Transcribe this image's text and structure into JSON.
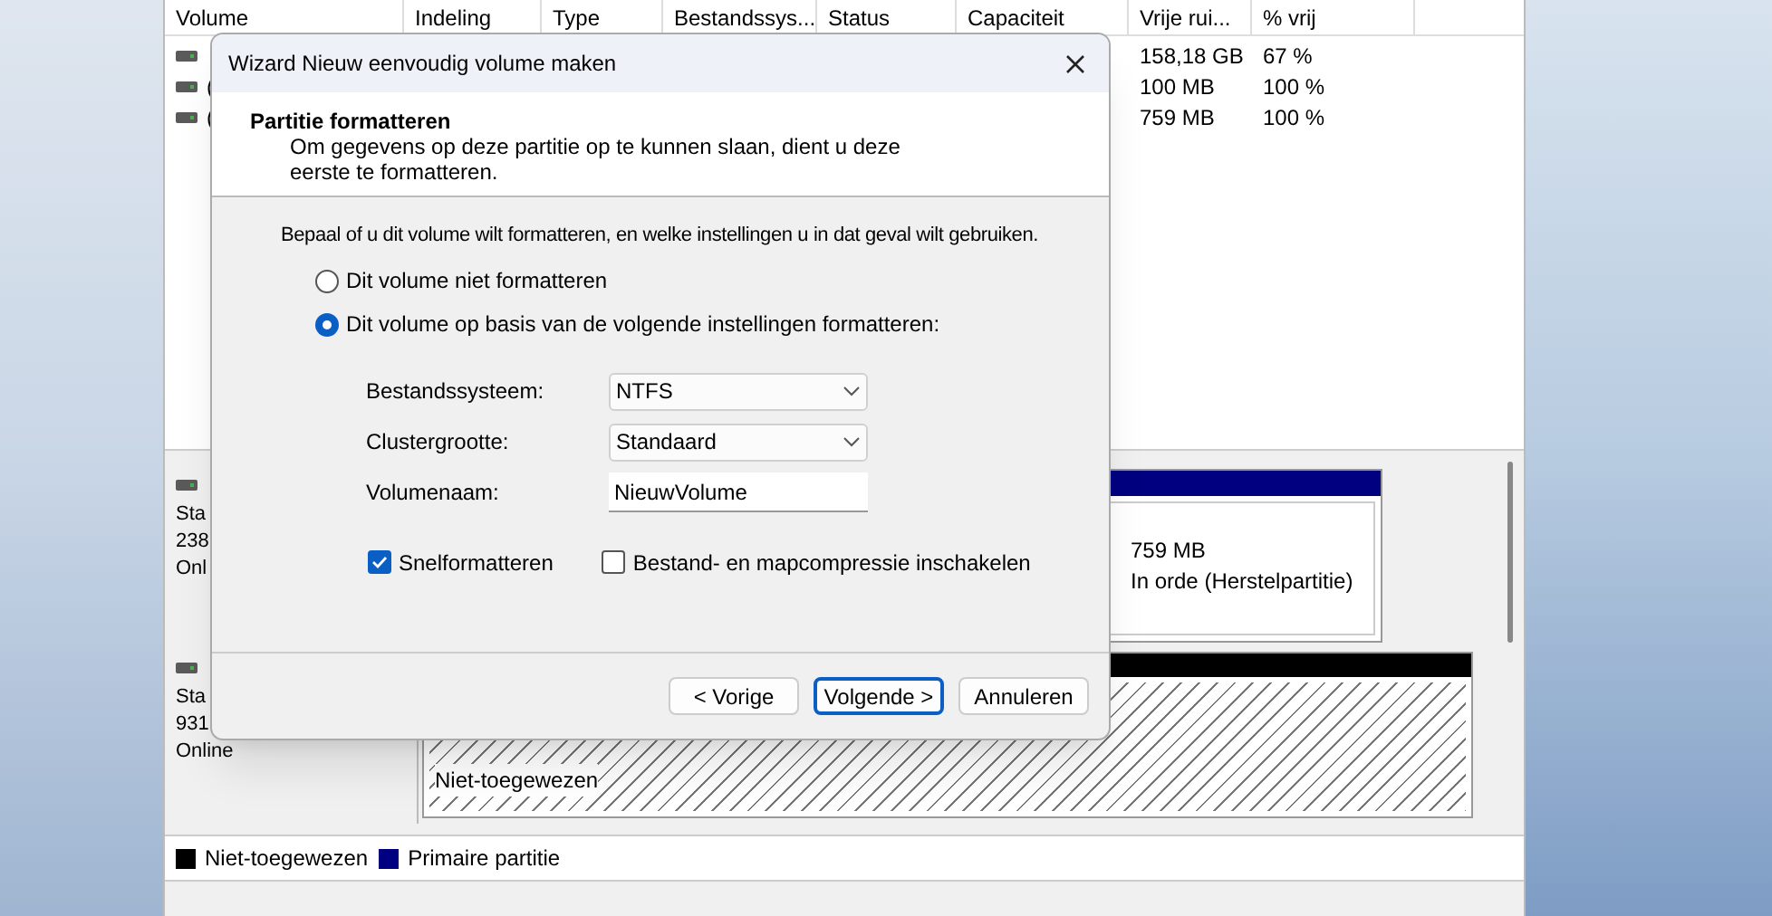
{
  "table": {
    "columns": [
      "Volume",
      "Indeling",
      "Type",
      "Bestandssys...",
      "Status",
      "Capaciteit",
      "Vrije rui...",
      "% vrij"
    ],
    "rows": [
      {
        "free": "158,18 GB",
        "percent": "67 %"
      },
      {
        "volume": "(",
        "free": "100 MB",
        "percent": "100 %"
      },
      {
        "volume": "(",
        "free": "759 MB",
        "percent": "100 %"
      }
    ]
  },
  "disks": [
    {
      "lines": [
        "Sta",
        "238",
        "Onl"
      ],
      "partitions": [
        {
          "kind": "primary",
          "size": "759 MB",
          "status": "In orde (Herstelpartitie)"
        }
      ]
    },
    {
      "lines": [
        "Sta",
        "931",
        "Online"
      ],
      "partitions": [
        {
          "kind": "unallocated",
          "label": "Niet-toegewezen"
        }
      ]
    }
  ],
  "legend": [
    {
      "label": "Niet-toegewezen",
      "color": "#000000"
    },
    {
      "label": "Primaire partitie",
      "color": "#000080"
    }
  ],
  "dialog": {
    "title": "Wizard Nieuw eenvoudig volume maken",
    "heading": "Partitie formatteren",
    "description": "Om gegevens op deze partitie op te kunnen slaan, dient u deze eerste te formatteren.",
    "instruction": "Bepaal of u dit volume wilt formatteren, en welke instellingen u in dat geval wilt gebruiken.",
    "options": [
      {
        "label": "Dit volume niet formatteren",
        "selected": false
      },
      {
        "label": "Dit volume op basis van de volgende instellingen formatteren:",
        "selected": true
      }
    ],
    "fields": [
      {
        "kind": "select",
        "label": "Bestandssysteem:",
        "value": "NTFS"
      },
      {
        "kind": "select",
        "label": "Clustergrootte:",
        "value": "Standaard"
      },
      {
        "kind": "text",
        "label": "Volumenaam:",
        "value": "NieuwVolume"
      }
    ],
    "checkboxes": [
      {
        "label": "Snelformatteren",
        "checked": true
      },
      {
        "label": "Bestand- en mapcompressie inschakelen",
        "checked": false
      }
    ],
    "buttons": [
      {
        "label": "< Vorige",
        "default": false
      },
      {
        "label": "Volgende >",
        "default": true
      },
      {
        "label": "Annuleren",
        "default": false
      }
    ]
  }
}
